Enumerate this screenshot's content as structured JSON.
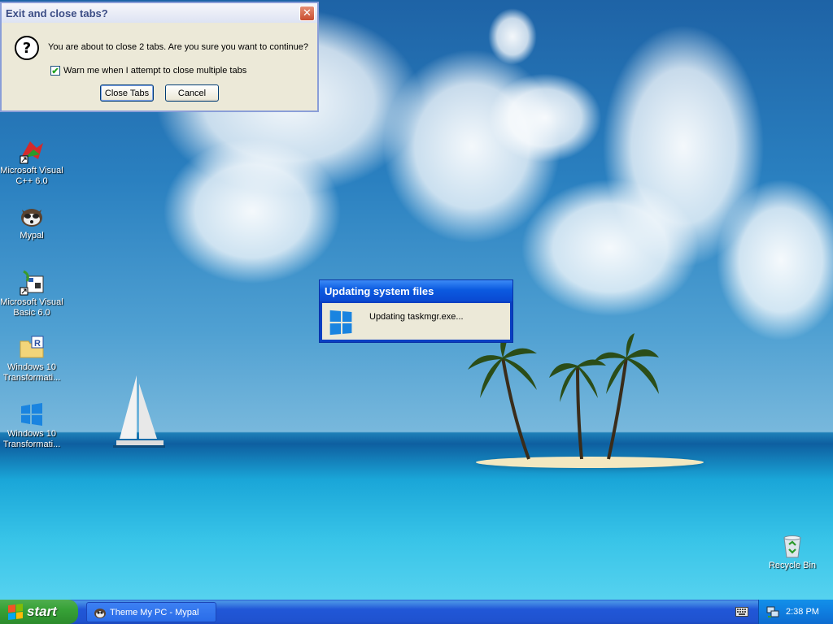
{
  "dialog": {
    "title": "Exit and close tabs?",
    "close_glyph": "✕",
    "icon_glyph": "?",
    "message": "You are about to close 2 tabs. Are you sure you want to continue?",
    "checkbox_label": "Warn me when I attempt to close multiple tabs",
    "checkbox_checked": true,
    "check_glyph": "✔",
    "close_tabs_label": "Close Tabs",
    "cancel_label": "Cancel"
  },
  "update_popup": {
    "title": "Updating system files",
    "message": "Updating taskmgr.exe..."
  },
  "desktop_icons": [
    {
      "label": "Microsoft Visual C++ 6.0",
      "icon": "visual-cpp-icon"
    },
    {
      "label": "Mypal",
      "icon": "mypal-icon"
    },
    {
      "label": "Microsoft Visual Basic 6.0",
      "icon": "visual-basic-icon"
    },
    {
      "label": "Windows 10 Transformati...",
      "icon": "folder-r-icon"
    },
    {
      "label": "Windows 10 Transformati...",
      "icon": "windows-logo-icon"
    },
    {
      "label": "Recycle Bin",
      "icon": "recycle-bin-icon"
    }
  ],
  "taskbar": {
    "start_label": "start",
    "task_item": "Theme My PC - Mypal",
    "clock": "2:38 PM"
  },
  "colors": {
    "titlebar_blue": "#0b5ae0",
    "start_green": "#37a237",
    "taskbar_blue": "#2157d7"
  }
}
